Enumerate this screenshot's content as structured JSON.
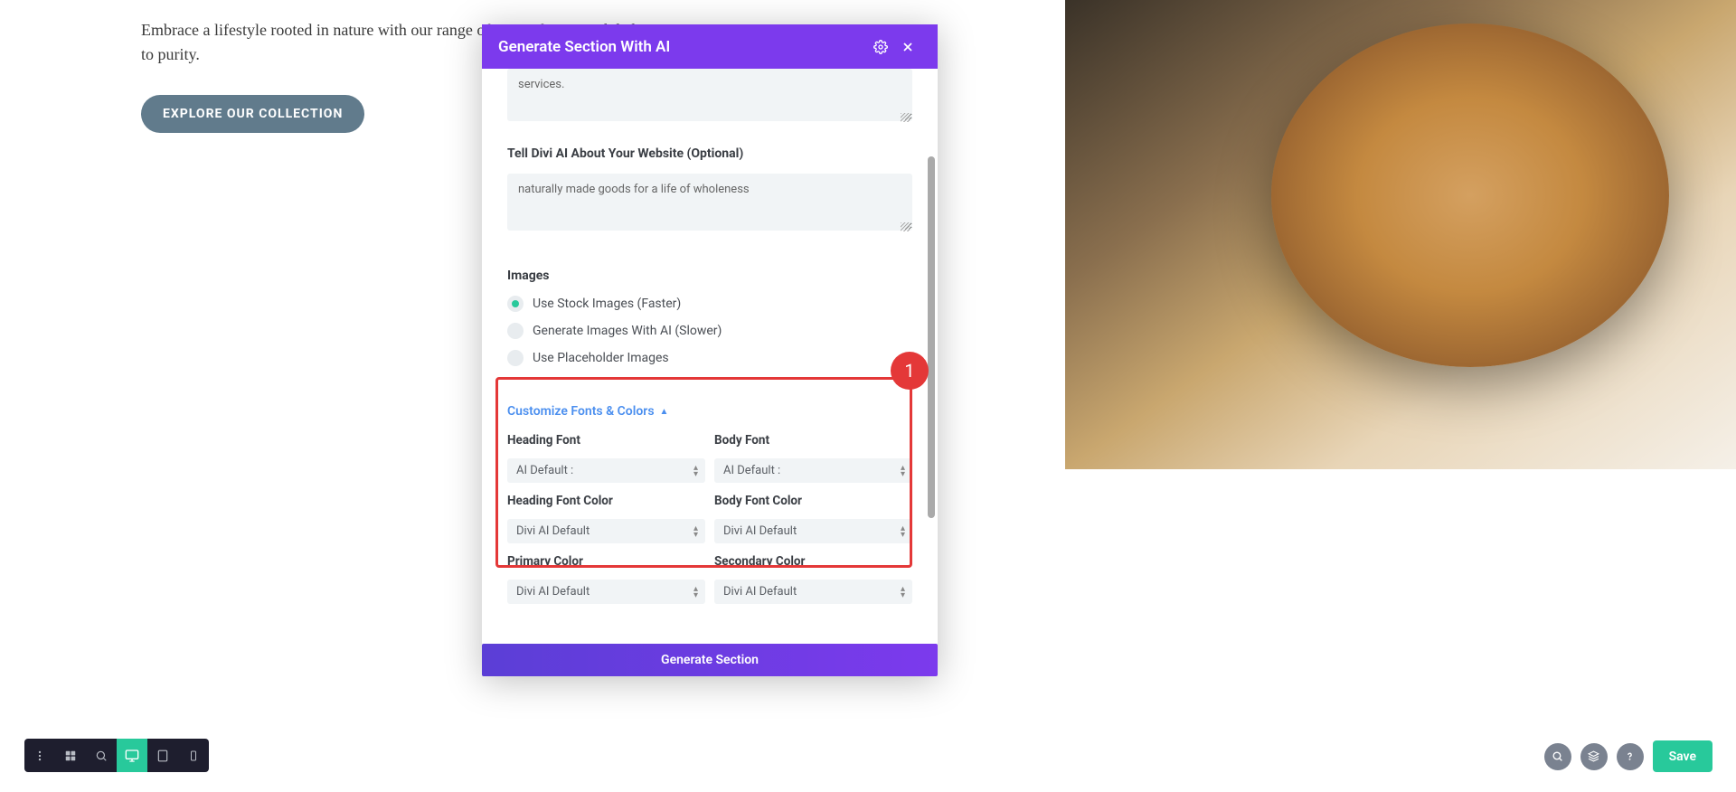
{
  "page": {
    "hero_text": "Embrace a lifestyle rooted in nature with our range of ---- with care and dedication to purity.",
    "explore_button": "EXPLORE OUR COLLECTION"
  },
  "modal": {
    "title": "Generate Section With AI",
    "desc_value": "services.",
    "about_label": "Tell Divi AI About Your Website (Optional)",
    "about_value": "naturally made goods for a life of wholeness",
    "images_label": "Images",
    "radio_stock": "Use Stock Images (Faster)",
    "radio_ai": "Generate Images With AI (Slower)",
    "radio_placeholder": "Use Placeholder Images",
    "expand_label": "Customize Fonts & Colors",
    "fields": {
      "heading_font_label": "Heading Font",
      "heading_font_value": "AI Default :",
      "body_font_label": "Body Font",
      "body_font_value": "AI Default :",
      "heading_color_label": "Heading Font Color",
      "heading_color_value": "Divi AI Default",
      "body_color_label": "Body Font Color",
      "body_color_value": "Divi AI Default",
      "primary_color_label": "Primary Color",
      "primary_color_value": "Divi AI Default",
      "secondary_color_label": "Secondary Color",
      "secondary_color_value": "Divi AI Default"
    },
    "footer_button": "Generate Section"
  },
  "highlight": {
    "badge": "1"
  },
  "bottom": {
    "save": "Save"
  }
}
